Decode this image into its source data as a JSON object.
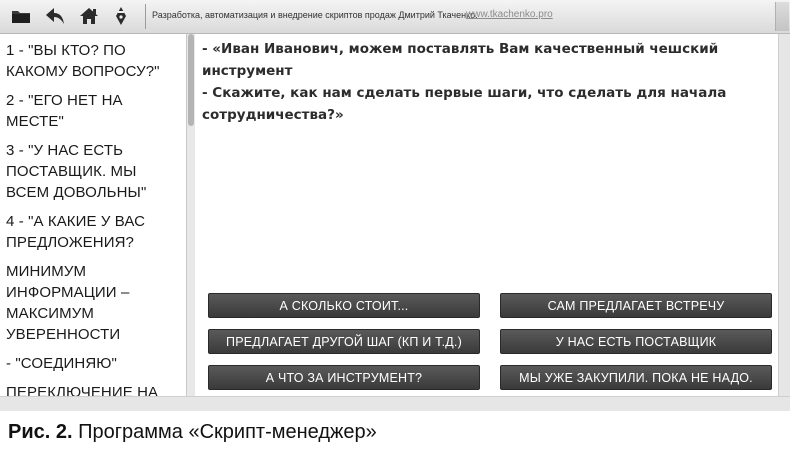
{
  "toolbar": {
    "icons": [
      "folder-icon",
      "back-arrow-icon",
      "home-icon",
      "pen-icon"
    ],
    "caption": "Разработка, автоматизация и внедрение скриптов продаж Дмитрий Ткаченко.",
    "link": "www.tkachenko.pro"
  },
  "sidebar": {
    "items": [
      "1 - \"ВЫ КТО? ПО КАКОМУ ВОПРОСУ?\"",
      "2 - \"ЕГО НЕТ НА МЕСТЕ\"",
      "3 - \"У НАС ЕСТЬ ПОСТАВЩИК. МЫ ВСЕМ ДОВОЛЬНЫ\"",
      "4 - \"А КАКИЕ У ВАС ПРЕДЛОЖЕНИЯ?",
      "МИНИМУМ ИНФОРМАЦИИ – МАКСИМУМ УВЕРЕННОСТИ",
      "- \"СОЕДИНЯЮ\"",
      "ПЕРЕКЛЮЧЕНИЕ НА"
    ]
  },
  "dialog": {
    "line1": "- «Иван Иванович, можем поставлять Вам качественный чешский инструмент",
    "line2": "- Скажите, как нам сделать первые шаги, что сделать для начала",
    "line3": "сотрудничества?»"
  },
  "buttons": {
    "how_much": "А СКОЛЬКО СТОИТ...",
    "offers_meeting": "САМ ПРЕДЛАГАЕТ ВСТРЕЧУ",
    "other_step": "ПРЕДЛАГАЕТ ДРУГОЙ ШАГ (КП И Т.Д.)",
    "have_supplier": "У НАС ЕСТЬ ПОСТАВЩИК",
    "what_instrument": "А ЧТО ЗА ИНСТРУМЕНТ?",
    "already_bought": "МЫ УЖЕ ЗАКУПИЛИ. ПОКА НЕ НАДО."
  },
  "figure": {
    "label": "Рис. 2.",
    "title": " Программа «Скрипт-менеджер»"
  }
}
